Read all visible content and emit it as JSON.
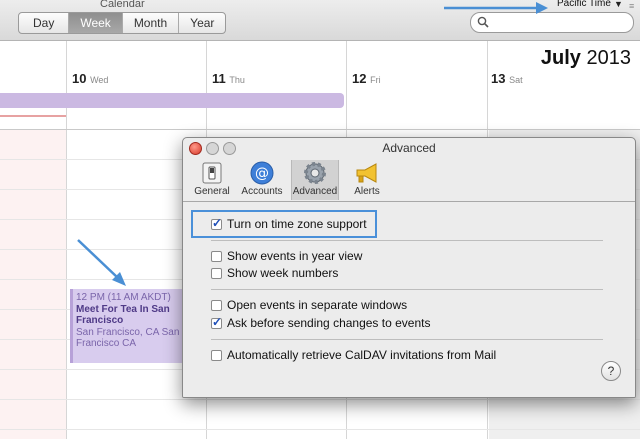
{
  "window": {
    "title": "Calendar"
  },
  "toolbar": {
    "views": [
      "Day",
      "Week",
      "Month",
      "Year"
    ],
    "active_view": "Week",
    "timezone_label": "Pacific Time",
    "timezone_arrow": "▼"
  },
  "calendar": {
    "month": "July",
    "year": "2013",
    "days": [
      {
        "num": "10",
        "name": "Wed"
      },
      {
        "num": "11",
        "name": "Thu"
      },
      {
        "num": "12",
        "name": "Fri"
      },
      {
        "num": "13",
        "name": "Sat"
      }
    ],
    "event": {
      "time": "12 PM (11 AM AKDT)",
      "title": "Meet For Tea In San Francisco",
      "location": "San Francisco, CA San Francisco CA"
    }
  },
  "dialog": {
    "title": "Advanced",
    "tabs": [
      {
        "label": "General",
        "icon": "switch-icon"
      },
      {
        "label": "Accounts",
        "icon": "at-sign-icon"
      },
      {
        "label": "Advanced",
        "icon": "gear-icon"
      },
      {
        "label": "Alerts",
        "icon": "megaphone-icon"
      }
    ],
    "active_tab": "Advanced",
    "options": [
      {
        "label": "Turn on time zone support",
        "checked": true
      },
      {
        "label": "Show events in year view",
        "checked": false
      },
      {
        "label": "Show week numbers",
        "checked": false
      },
      {
        "label": "Open events in separate windows",
        "checked": false
      },
      {
        "label": "Ask before sending changes to events",
        "checked": true
      },
      {
        "label": "Automatically retrieve CalDAV invitations from Mail",
        "checked": false
      }
    ],
    "help_label": "?"
  },
  "colors": {
    "accent_blue": "#4a90d9",
    "event_purple": "#d8ccee",
    "allday_purple": "#cbb9e2"
  }
}
